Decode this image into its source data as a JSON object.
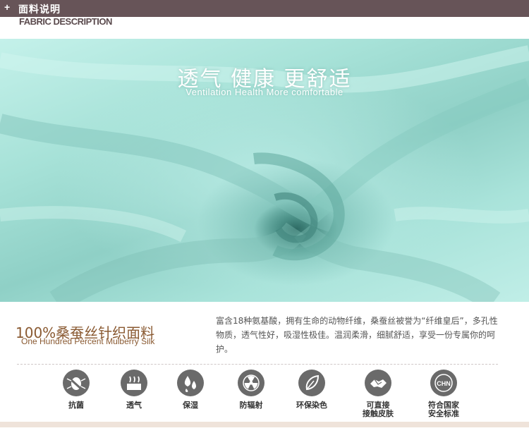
{
  "header": {
    "plus": "+",
    "title": "面料说明",
    "subtitle": "FABRIC DESCRIPTION"
  },
  "banner": {
    "title": "透气  健康  更舒适",
    "subtitle": "Ventilation  Health  More comfortable"
  },
  "product": {
    "title": "100%桑蚕丝针织面料",
    "subtitle": "One Hundred Percent Mulberry Silk",
    "description": "富含18种氨基酸，拥有生命的动物纤维，桑蚕丝被誉为“纤维皇后”，多孔性物质，透气性好，吸湿性极佳。温润柔滑，细腻舒适，享受一份专属你的呵护。"
  },
  "features": [
    {
      "icon": "antibacterial-icon",
      "label": "抗菌"
    },
    {
      "icon": "breathable-icon",
      "label": "透气"
    },
    {
      "icon": "moisture-icon",
      "label": "保湿"
    },
    {
      "icon": "radiation-icon",
      "label": "防辐射"
    },
    {
      "icon": "eco-dye-icon",
      "label": "环保染色"
    },
    {
      "icon": "skin-contact-icon",
      "label": "可直接\n接触皮肤"
    },
    {
      "icon": "chn-standard-icon",
      "label": "符合国家\n安全标准",
      "badge": "CHN"
    }
  ],
  "colors": {
    "header_bg": "#675458",
    "icon_bg": "#6a6a6a",
    "accent_brown": "#8a5a32",
    "fabric_mint": "#a7e2d8"
  }
}
